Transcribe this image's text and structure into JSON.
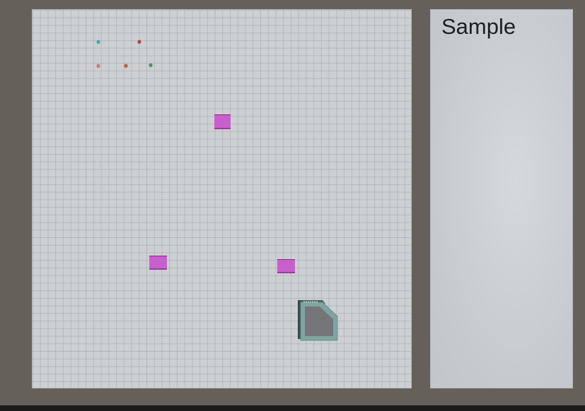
{
  "side_panel": {
    "title": "Sample"
  },
  "colors": {
    "background": "#656059",
    "board": "#cdd0d3",
    "block": "#c95fcc",
    "agent_frame": "#7fa5a3",
    "agent_body": "#747677"
  },
  "scene": {
    "dots": [
      {
        "color": "#39a9c9",
        "icon": "cyan-dot"
      },
      {
        "color": "#c93a2f",
        "icon": "red-dot"
      },
      {
        "color": "#cf7a88",
        "icon": "pink-dot"
      },
      {
        "color": "#c8591f",
        "icon": "orange-dot"
      },
      {
        "color": "#3a9a5b",
        "icon": "green-dot"
      }
    ],
    "blocks": [
      {
        "icon": "magenta-block"
      },
      {
        "icon": "magenta-block"
      },
      {
        "icon": "magenta-block"
      }
    ],
    "agent": {
      "icon": "teal-agent"
    }
  }
}
